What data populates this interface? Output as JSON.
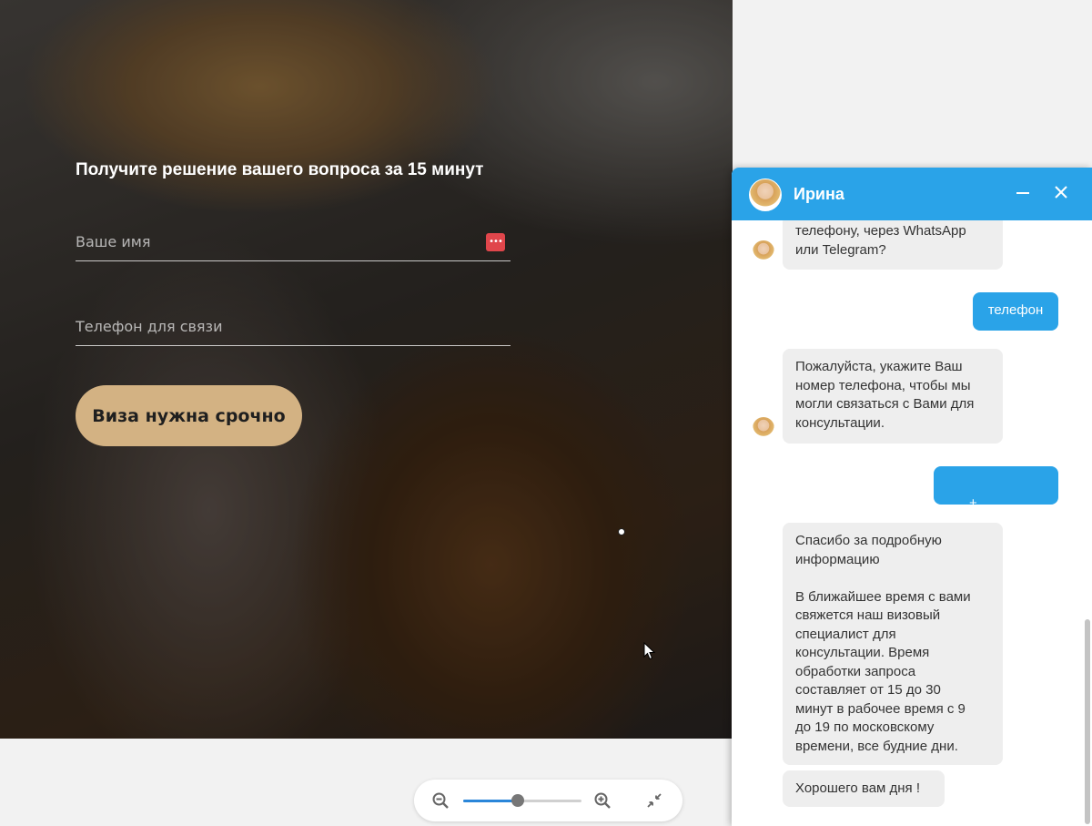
{
  "hero": {
    "heading": "Получите решение вашего вопроса за 15 минут",
    "name_placeholder": "Ваше имя",
    "phone_placeholder": "Телефон для связи",
    "submit_label": "Виза нужна срочно",
    "accent_color": "#d3b283"
  },
  "zoom": {
    "zoom_out_icon": "zoom-out-icon",
    "zoom_in_icon": "zoom-in-icon",
    "fit_icon": "collapse-icon",
    "level_fraction": 0.46
  },
  "chat": {
    "agent_name": "Ирина",
    "header_color": "#2aa3e8",
    "messages": [
      {
        "from": "agent",
        "text": "телефону, через WhatsApp\nили Telegram?"
      },
      {
        "from": "user",
        "text": "телефон"
      },
      {
        "from": "agent",
        "text": "Пожалуйста, укажите Ваш\nномер телефона, чтобы мы\nмогли связаться с Вами для\nконсультации."
      },
      {
        "from": "user",
        "text": "+"
      },
      {
        "from": "agent",
        "text": "Спасибо за подробную\nинформацию\n\nВ ближайшее время с вами\nсвяжется наш визовый\nспециалист для\nконсультации. Время\nобработки запроса\nсоставляет от 15 до 30\nминут в рабочее время с 9\nдо 19 по московскому\nвремени, все будние дни."
      },
      {
        "from": "agent",
        "text": "Хорошего вам дня !"
      }
    ]
  }
}
